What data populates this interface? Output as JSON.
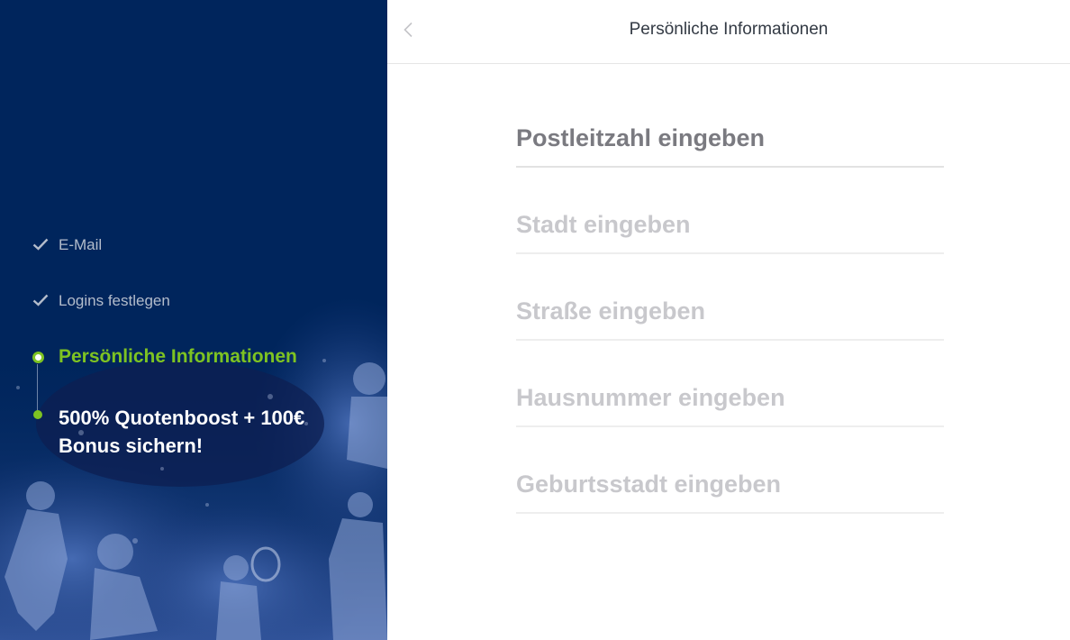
{
  "sidebar": {
    "steps": [
      {
        "label": "E-Mail",
        "state": "done",
        "icon": "check-icon"
      },
      {
        "label": "Logins festlegen",
        "state": "done",
        "icon": "check-icon"
      },
      {
        "label": "Persönliche Informationen",
        "state": "active"
      },
      {
        "label_line1": "500% Quotenboost + 100€",
        "label_line2": "Bonus sichern!",
        "state": "bonus"
      }
    ],
    "colors": {
      "background": "#00255c",
      "accent": "#7ec322",
      "done_text": "#b3bccb"
    }
  },
  "header": {
    "title": "Persönliche Informationen",
    "back_icon": "chevron-left-icon"
  },
  "form": {
    "fields": [
      {
        "placeholder": "Postleitzahl eingeben",
        "value": ""
      },
      {
        "placeholder": "Stadt eingeben",
        "value": ""
      },
      {
        "placeholder": "Straße eingeben",
        "value": ""
      },
      {
        "placeholder": "Hausnummer eingeben",
        "value": ""
      },
      {
        "placeholder": "Geburtsstadt eingeben",
        "value": ""
      }
    ]
  }
}
